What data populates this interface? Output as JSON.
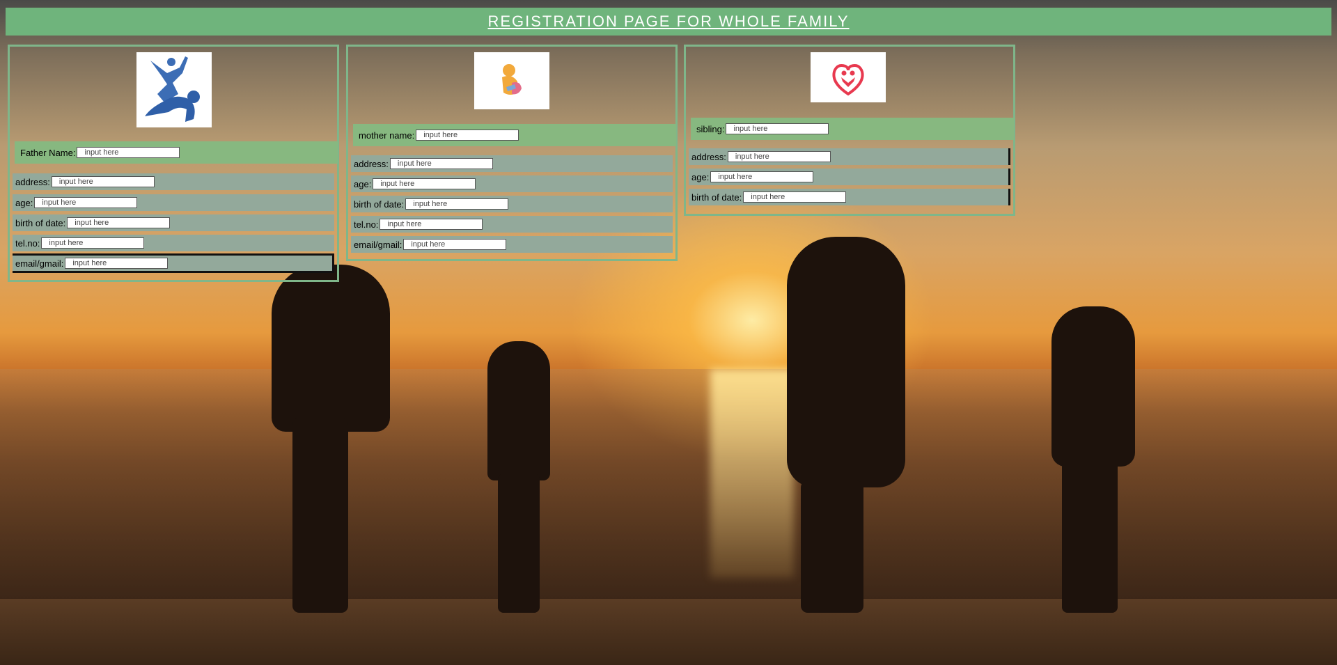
{
  "header": {
    "title": "REGISTRATION PAGE FOR WHOLE FAMILY"
  },
  "placeholder": "input here",
  "father": {
    "logo_icon": "father-child-icon",
    "name_label": "Father Name:",
    "fields": [
      {
        "label": "address:"
      },
      {
        "label": "age:"
      },
      {
        "label": "birth of date:"
      },
      {
        "label": "tel.no:"
      },
      {
        "label": "email/gmail:"
      }
    ]
  },
  "mother": {
    "logo_icon": "mother-child-icon",
    "name_label": "mother name:",
    "fields": [
      {
        "label": "address:"
      },
      {
        "label": "age:"
      },
      {
        "label": "birth of date:"
      },
      {
        "label": "tel.no:"
      },
      {
        "label": "email/gmail:"
      }
    ]
  },
  "sibling": {
    "logo_icon": "heart-family-icon",
    "name_label": "sibling:",
    "fields": [
      {
        "label": "address:"
      },
      {
        "label": "age:"
      },
      {
        "label": "birth of date:"
      }
    ]
  },
  "colors": {
    "header_bg": "#6fb47c",
    "name_row_bg": "#87b880",
    "field_row_bg": "#93a99b",
    "panel_border": "#7fb68a"
  }
}
